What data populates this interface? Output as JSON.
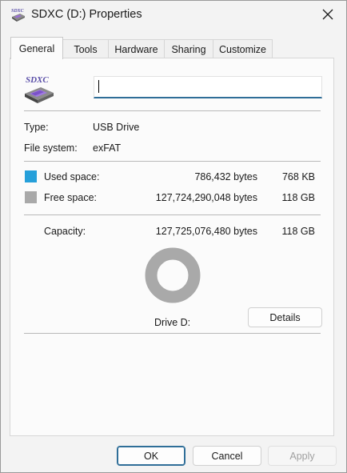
{
  "window": {
    "title": "SDXC (D:) Properties",
    "icon_name": "sd-card-drive-icon",
    "close_icon": "close-icon"
  },
  "tabs": [
    {
      "label": "General",
      "active": true
    },
    {
      "label": "Tools",
      "active": false
    },
    {
      "label": "Hardware",
      "active": false
    },
    {
      "label": "Sharing",
      "active": false
    },
    {
      "label": "Customize",
      "active": false
    }
  ],
  "general": {
    "drive_icon": "sd-card-drive-icon",
    "drive_icon_text": "SDXC",
    "volume_label_value": "",
    "type_label": "Type:",
    "type_value": "USB Drive",
    "fs_label": "File system:",
    "fs_value": "exFAT",
    "used": {
      "label": "Used space:",
      "bytes": "786,432 bytes",
      "size": "768 KB",
      "color": "#26a0da"
    },
    "free": {
      "label": "Free space:",
      "bytes": "127,724,290,048 bytes",
      "size": "118 GB",
      "color": "#a9a9a9"
    },
    "capacity": {
      "label": "Capacity:",
      "bytes": "127,725,076,480 bytes",
      "size": "118 GB"
    },
    "used_fraction": 6.2e-06,
    "drive_label": "Drive D:",
    "details_label": "Details"
  },
  "buttons": {
    "ok": "OK",
    "cancel": "Cancel",
    "apply": "Apply"
  }
}
